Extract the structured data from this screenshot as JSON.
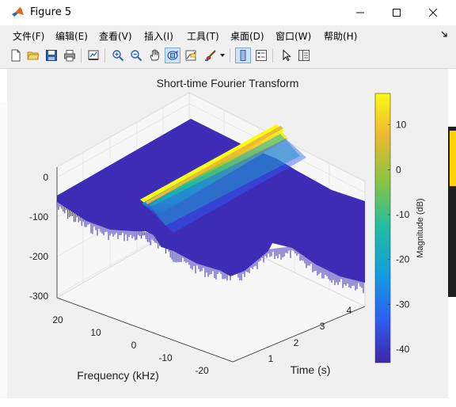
{
  "window": {
    "title": "Figure 5",
    "minimize": "—",
    "maximize": "☐",
    "close": "✕"
  },
  "menu": {
    "items": [
      "文件(F)",
      "编辑(E)",
      "查看(V)",
      "插入(I)",
      "工具(T)",
      "桌面(D)",
      "窗口(W)",
      "帮助(H)"
    ]
  },
  "toolbar": {
    "icons": [
      "new-figure-icon",
      "open-file-icon",
      "save-icon",
      "print-icon",
      "link-plot-icon",
      "zoom-in-icon",
      "zoom-out-icon",
      "pan-icon",
      "rotate-3d-icon",
      "data-cursor-icon",
      "brush-icon",
      "brush-dropdown-icon",
      "colorbar-icon",
      "legend-icon",
      "edit-plot-icon",
      "property-inspector-icon"
    ]
  },
  "chart_data": {
    "type": "surface",
    "title": "Short-time Fourier Transform",
    "xlabel": "Time (s)",
    "ylabel": "Frequency (kHz)",
    "zlabel": "",
    "x_ticks": [
      "1",
      "2",
      "3",
      "4"
    ],
    "y_ticks": [
      "20",
      "10",
      "0",
      "-10",
      "-20"
    ],
    "z_ticks": [
      "0",
      "-100",
      "-200",
      "-300"
    ],
    "colorbar": {
      "label": "Magnitude (dB)",
      "ticks": [
        "10",
        "0",
        "-10",
        "-20",
        "-30",
        "-40"
      ],
      "range": [
        -43,
        17
      ],
      "colors": [
        "#3e26a8",
        "#2e5ef3",
        "#149ae0",
        "#1fbda3",
        "#8cc53f",
        "#f0b92f",
        "#f9fb15"
      ]
    },
    "surface_color": "#3d2cb5",
    "ridge_color": "#f9fb15"
  }
}
